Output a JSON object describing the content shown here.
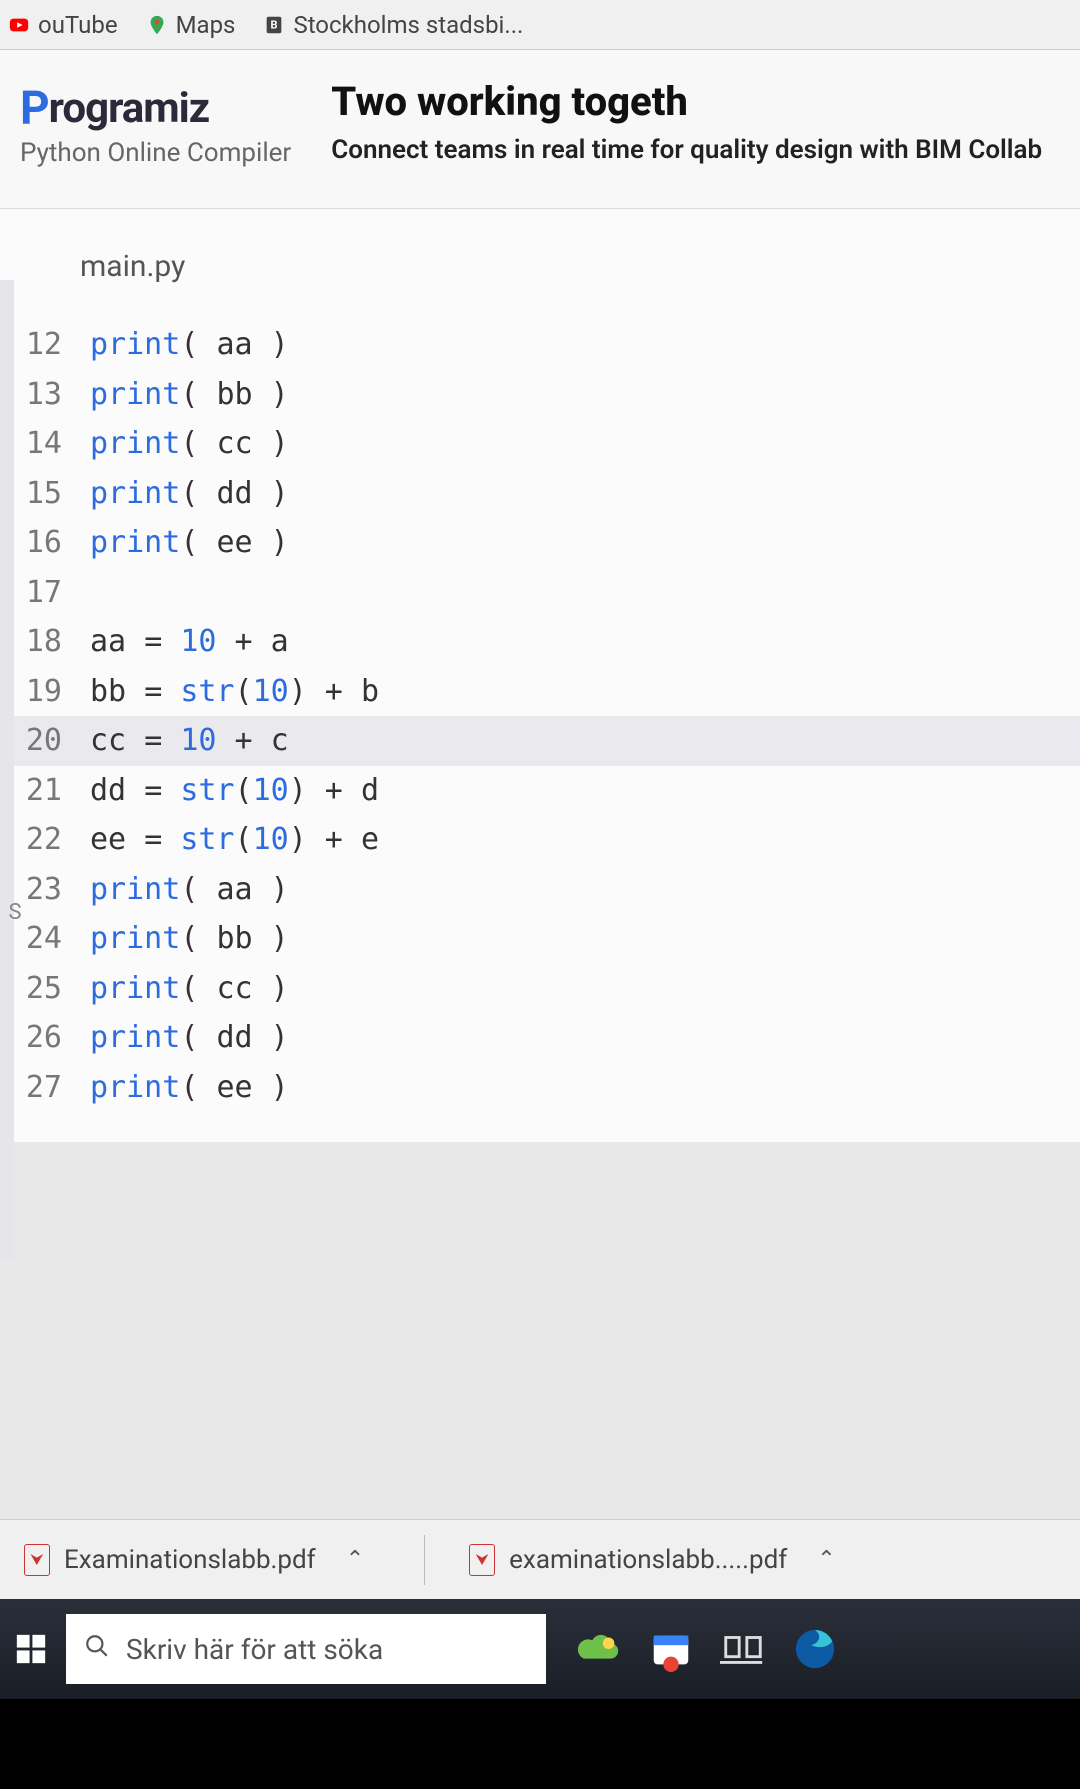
{
  "bookmarks": [
    {
      "label": "ouTube",
      "icon": "youtube"
    },
    {
      "label": "Maps",
      "icon": "maps"
    },
    {
      "label": "Stockholms stadsbi...",
      "icon": "library"
    }
  ],
  "logo": {
    "brand_prefix": "P",
    "brand_rest": "rogramiz",
    "subtitle": "Python Online Compiler"
  },
  "ad": {
    "title": "Two working togeth",
    "subtitle": "Connect teams in real time for quality design with BIM Collab"
  },
  "editor": {
    "filename": "main.py",
    "highlight_line": 20,
    "lines": [
      {
        "n": 12,
        "tokens": [
          [
            "fn",
            "print"
          ],
          [
            "op",
            "( "
          ],
          [
            "id",
            "aa"
          ],
          [
            "op",
            " )"
          ]
        ]
      },
      {
        "n": 13,
        "tokens": [
          [
            "fn",
            "print"
          ],
          [
            "op",
            "( "
          ],
          [
            "id",
            "bb"
          ],
          [
            "op",
            " )"
          ]
        ]
      },
      {
        "n": 14,
        "tokens": [
          [
            "fn",
            "print"
          ],
          [
            "op",
            "( "
          ],
          [
            "id",
            "cc"
          ],
          [
            "op",
            " )"
          ]
        ]
      },
      {
        "n": 15,
        "tokens": [
          [
            "fn",
            "print"
          ],
          [
            "op",
            "( "
          ],
          [
            "id",
            "dd"
          ],
          [
            "op",
            " )"
          ]
        ]
      },
      {
        "n": 16,
        "tokens": [
          [
            "fn",
            "print"
          ],
          [
            "op",
            "( "
          ],
          [
            "id",
            "ee"
          ],
          [
            "op",
            " )"
          ]
        ]
      },
      {
        "n": 17,
        "tokens": []
      },
      {
        "n": 18,
        "tokens": [
          [
            "id",
            "aa "
          ],
          [
            "op",
            "= "
          ],
          [
            "num",
            "10"
          ],
          [
            "op",
            " + "
          ],
          [
            "id",
            "a"
          ]
        ]
      },
      {
        "n": 19,
        "tokens": [
          [
            "id",
            "bb "
          ],
          [
            "op",
            "= "
          ],
          [
            "builtin",
            "str"
          ],
          [
            "op",
            "("
          ],
          [
            "num",
            "10"
          ],
          [
            "op",
            ") + "
          ],
          [
            "id",
            "b"
          ]
        ]
      },
      {
        "n": 20,
        "tokens": [
          [
            "id",
            "cc "
          ],
          [
            "op",
            "= "
          ],
          [
            "num",
            "10"
          ],
          [
            "op",
            " + "
          ],
          [
            "id",
            "c"
          ]
        ]
      },
      {
        "n": 21,
        "tokens": [
          [
            "id",
            "dd "
          ],
          [
            "op",
            "= "
          ],
          [
            "builtin",
            "str"
          ],
          [
            "op",
            "("
          ],
          [
            "num",
            "10"
          ],
          [
            "op",
            ") + "
          ],
          [
            "id",
            "d"
          ]
        ]
      },
      {
        "n": 22,
        "tokens": [
          [
            "id",
            "ee "
          ],
          [
            "op",
            "= "
          ],
          [
            "builtin",
            "str"
          ],
          [
            "op",
            "("
          ],
          [
            "num",
            "10"
          ],
          [
            "op",
            ") + "
          ],
          [
            "id",
            "e"
          ]
        ]
      },
      {
        "n": 23,
        "tokens": [
          [
            "fn",
            "print"
          ],
          [
            "op",
            "( "
          ],
          [
            "id",
            "aa"
          ],
          [
            "op",
            " )"
          ]
        ]
      },
      {
        "n": 24,
        "tokens": [
          [
            "fn",
            "print"
          ],
          [
            "op",
            "( "
          ],
          [
            "id",
            "bb"
          ],
          [
            "op",
            " )"
          ]
        ]
      },
      {
        "n": 25,
        "tokens": [
          [
            "fn",
            "print"
          ],
          [
            "op",
            "( "
          ],
          [
            "id",
            "cc"
          ],
          [
            "op",
            " )"
          ]
        ]
      },
      {
        "n": 26,
        "tokens": [
          [
            "fn",
            "print"
          ],
          [
            "op",
            "( "
          ],
          [
            "id",
            "dd"
          ],
          [
            "op",
            " )"
          ]
        ]
      },
      {
        "n": 27,
        "tokens": [
          [
            "fn",
            "print"
          ],
          [
            "op",
            "( "
          ],
          [
            "id",
            "ee"
          ],
          [
            "op",
            " )"
          ]
        ]
      }
    ]
  },
  "downloads": [
    {
      "label": "Examinationslabb.pdf"
    },
    {
      "label": "examinationslabb.....pdf"
    }
  ],
  "taskbar": {
    "search_placeholder": "Skriv här för att söka"
  }
}
